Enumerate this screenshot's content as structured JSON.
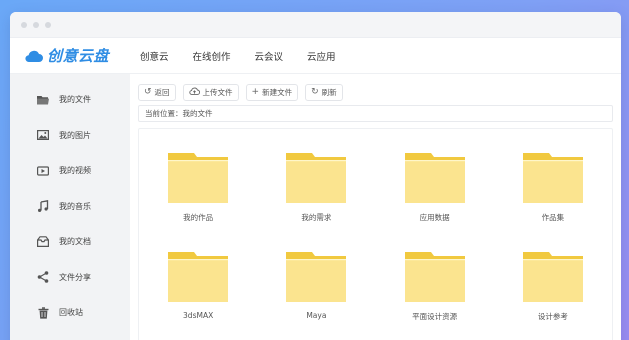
{
  "app": {
    "logo_text": "创意云盘",
    "brand_color": "#2f8de4",
    "folder_color": "#fbe48f",
    "folder_tab_color": "#f1c93f"
  },
  "topnav": {
    "items": [
      {
        "label": "创意云"
      },
      {
        "label": "在线创作"
      },
      {
        "label": "云会议"
      },
      {
        "label": "云应用"
      }
    ]
  },
  "sidebar": {
    "items": [
      {
        "label": "我的文件",
        "icon": "folder-icon"
      },
      {
        "label": "我的图片",
        "icon": "image-icon"
      },
      {
        "label": "我的视频",
        "icon": "video-icon"
      },
      {
        "label": "我的音乐",
        "icon": "music-icon"
      },
      {
        "label": "我的文档",
        "icon": "document-icon"
      },
      {
        "label": "文件分享",
        "icon": "share-icon"
      },
      {
        "label": "回收站",
        "icon": "trash-icon"
      }
    ]
  },
  "toolbar": {
    "back_label": "返回",
    "upload_label": "上传文件",
    "new_label": "新建文件",
    "refresh_label": "刷新"
  },
  "breadcrumb": {
    "text": "当前位置：我的文件"
  },
  "folders": [
    {
      "name": "我的作品"
    },
    {
      "name": "我的需求"
    },
    {
      "name": "应用数据"
    },
    {
      "name": "作品集"
    },
    {
      "name": "3dsMAX"
    },
    {
      "name": "Maya"
    },
    {
      "name": "平面设计资源"
    },
    {
      "name": "设计参考"
    }
  ]
}
